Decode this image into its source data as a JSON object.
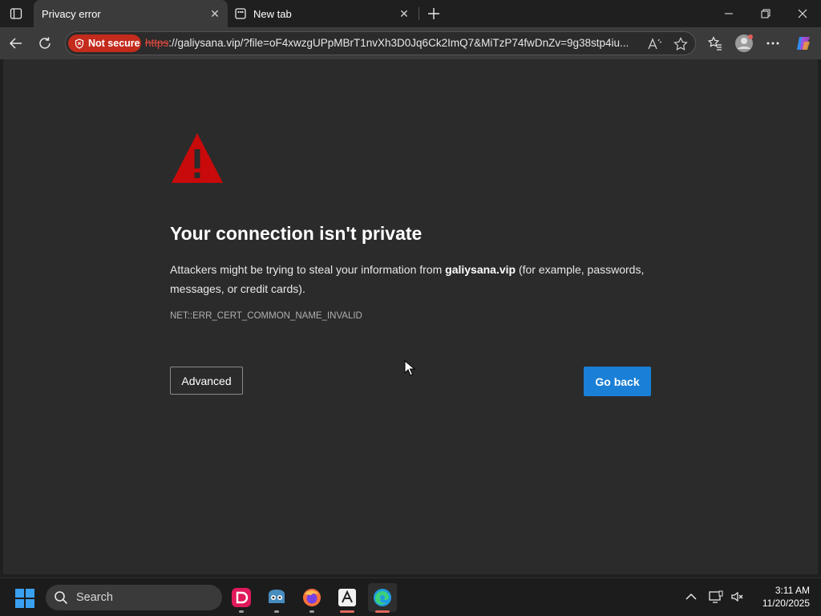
{
  "browser": {
    "tabs": [
      {
        "title": "Privacy error",
        "active": true
      },
      {
        "title": "New tab",
        "active": false
      }
    ],
    "security_label": "Not secure",
    "url_scheme": "https",
    "url_rest": "://galiysana.vip/?file=oF4xwzgUPpMBrT1nvXh3D0Jq6Ck2ImQ7&MiTzP74fwDnZv=9g38stp4iu..."
  },
  "page": {
    "headline": "Your connection isn't private",
    "desc_before": "Attackers might be trying to steal your information from ",
    "desc_domain": "galiysana.vip",
    "desc_after": " (for example, passwords, messages, or credit cards).",
    "error_code": "NET::ERR_CERT_COMMON_NAME_INVALID",
    "advanced_label": "Advanced",
    "goback_label": "Go back"
  },
  "taskbar": {
    "search_label": "Search",
    "time": "3:11 AM",
    "date": "11/20/2025"
  },
  "colors": {
    "accent": "#1a7fd6",
    "warning": "#c42b1c"
  }
}
